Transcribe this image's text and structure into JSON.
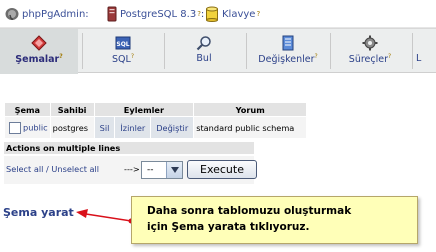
{
  "breadcrumb": {
    "items": [
      {
        "label": "phpPgAdmin",
        "icon": "elephant-icon"
      },
      {
        "label": "PostgreSQL 8.3",
        "sup": "?",
        "icon": "server-icon"
      },
      {
        "label": "Klavye",
        "sup": "?",
        "icon": "database-icon"
      }
    ],
    "separator": ":"
  },
  "tabs": [
    {
      "label": "Şemalar",
      "sup": "?",
      "icon": "schemas-icon",
      "active": true
    },
    {
      "label": "SQL",
      "sup": "?",
      "icon": "sql-icon",
      "active": false
    },
    {
      "label": "Bul",
      "sup": "",
      "icon": "search-icon",
      "active": false
    },
    {
      "label": "Değişkenler",
      "sup": "?",
      "icon": "variables-icon",
      "active": false
    },
    {
      "label": "Süreçler",
      "sup": "?",
      "icon": "processes-icon",
      "active": false
    },
    {
      "label": "L",
      "sup": "",
      "icon": "locks-icon",
      "active": false
    }
  ],
  "table": {
    "headers": {
      "schema": "Şema",
      "owner": "Sahibi",
      "actions": "Eylemler",
      "comment": "Yorum"
    },
    "rows": [
      {
        "schema": "public",
        "owner": "postgres",
        "actions": [
          "Sil",
          "İzinler",
          "Değiştir"
        ],
        "comment": "standard public schema"
      }
    ]
  },
  "multi_actions": {
    "title": "Actions on multiple lines",
    "select_link": "Select all / Unselect all",
    "arrow": "--->",
    "select_value": "--",
    "execute_label": "Execute"
  },
  "create_link": "Şema yarat",
  "callout": {
    "line1": "Daha sonra tablomuzu oluşturmak",
    "line2": "için Şema yarata tıklıyoruz."
  },
  "colors": {
    "link": "#2c4189",
    "callout_bg": "#ffffb8",
    "arrow": "#d9101a"
  }
}
